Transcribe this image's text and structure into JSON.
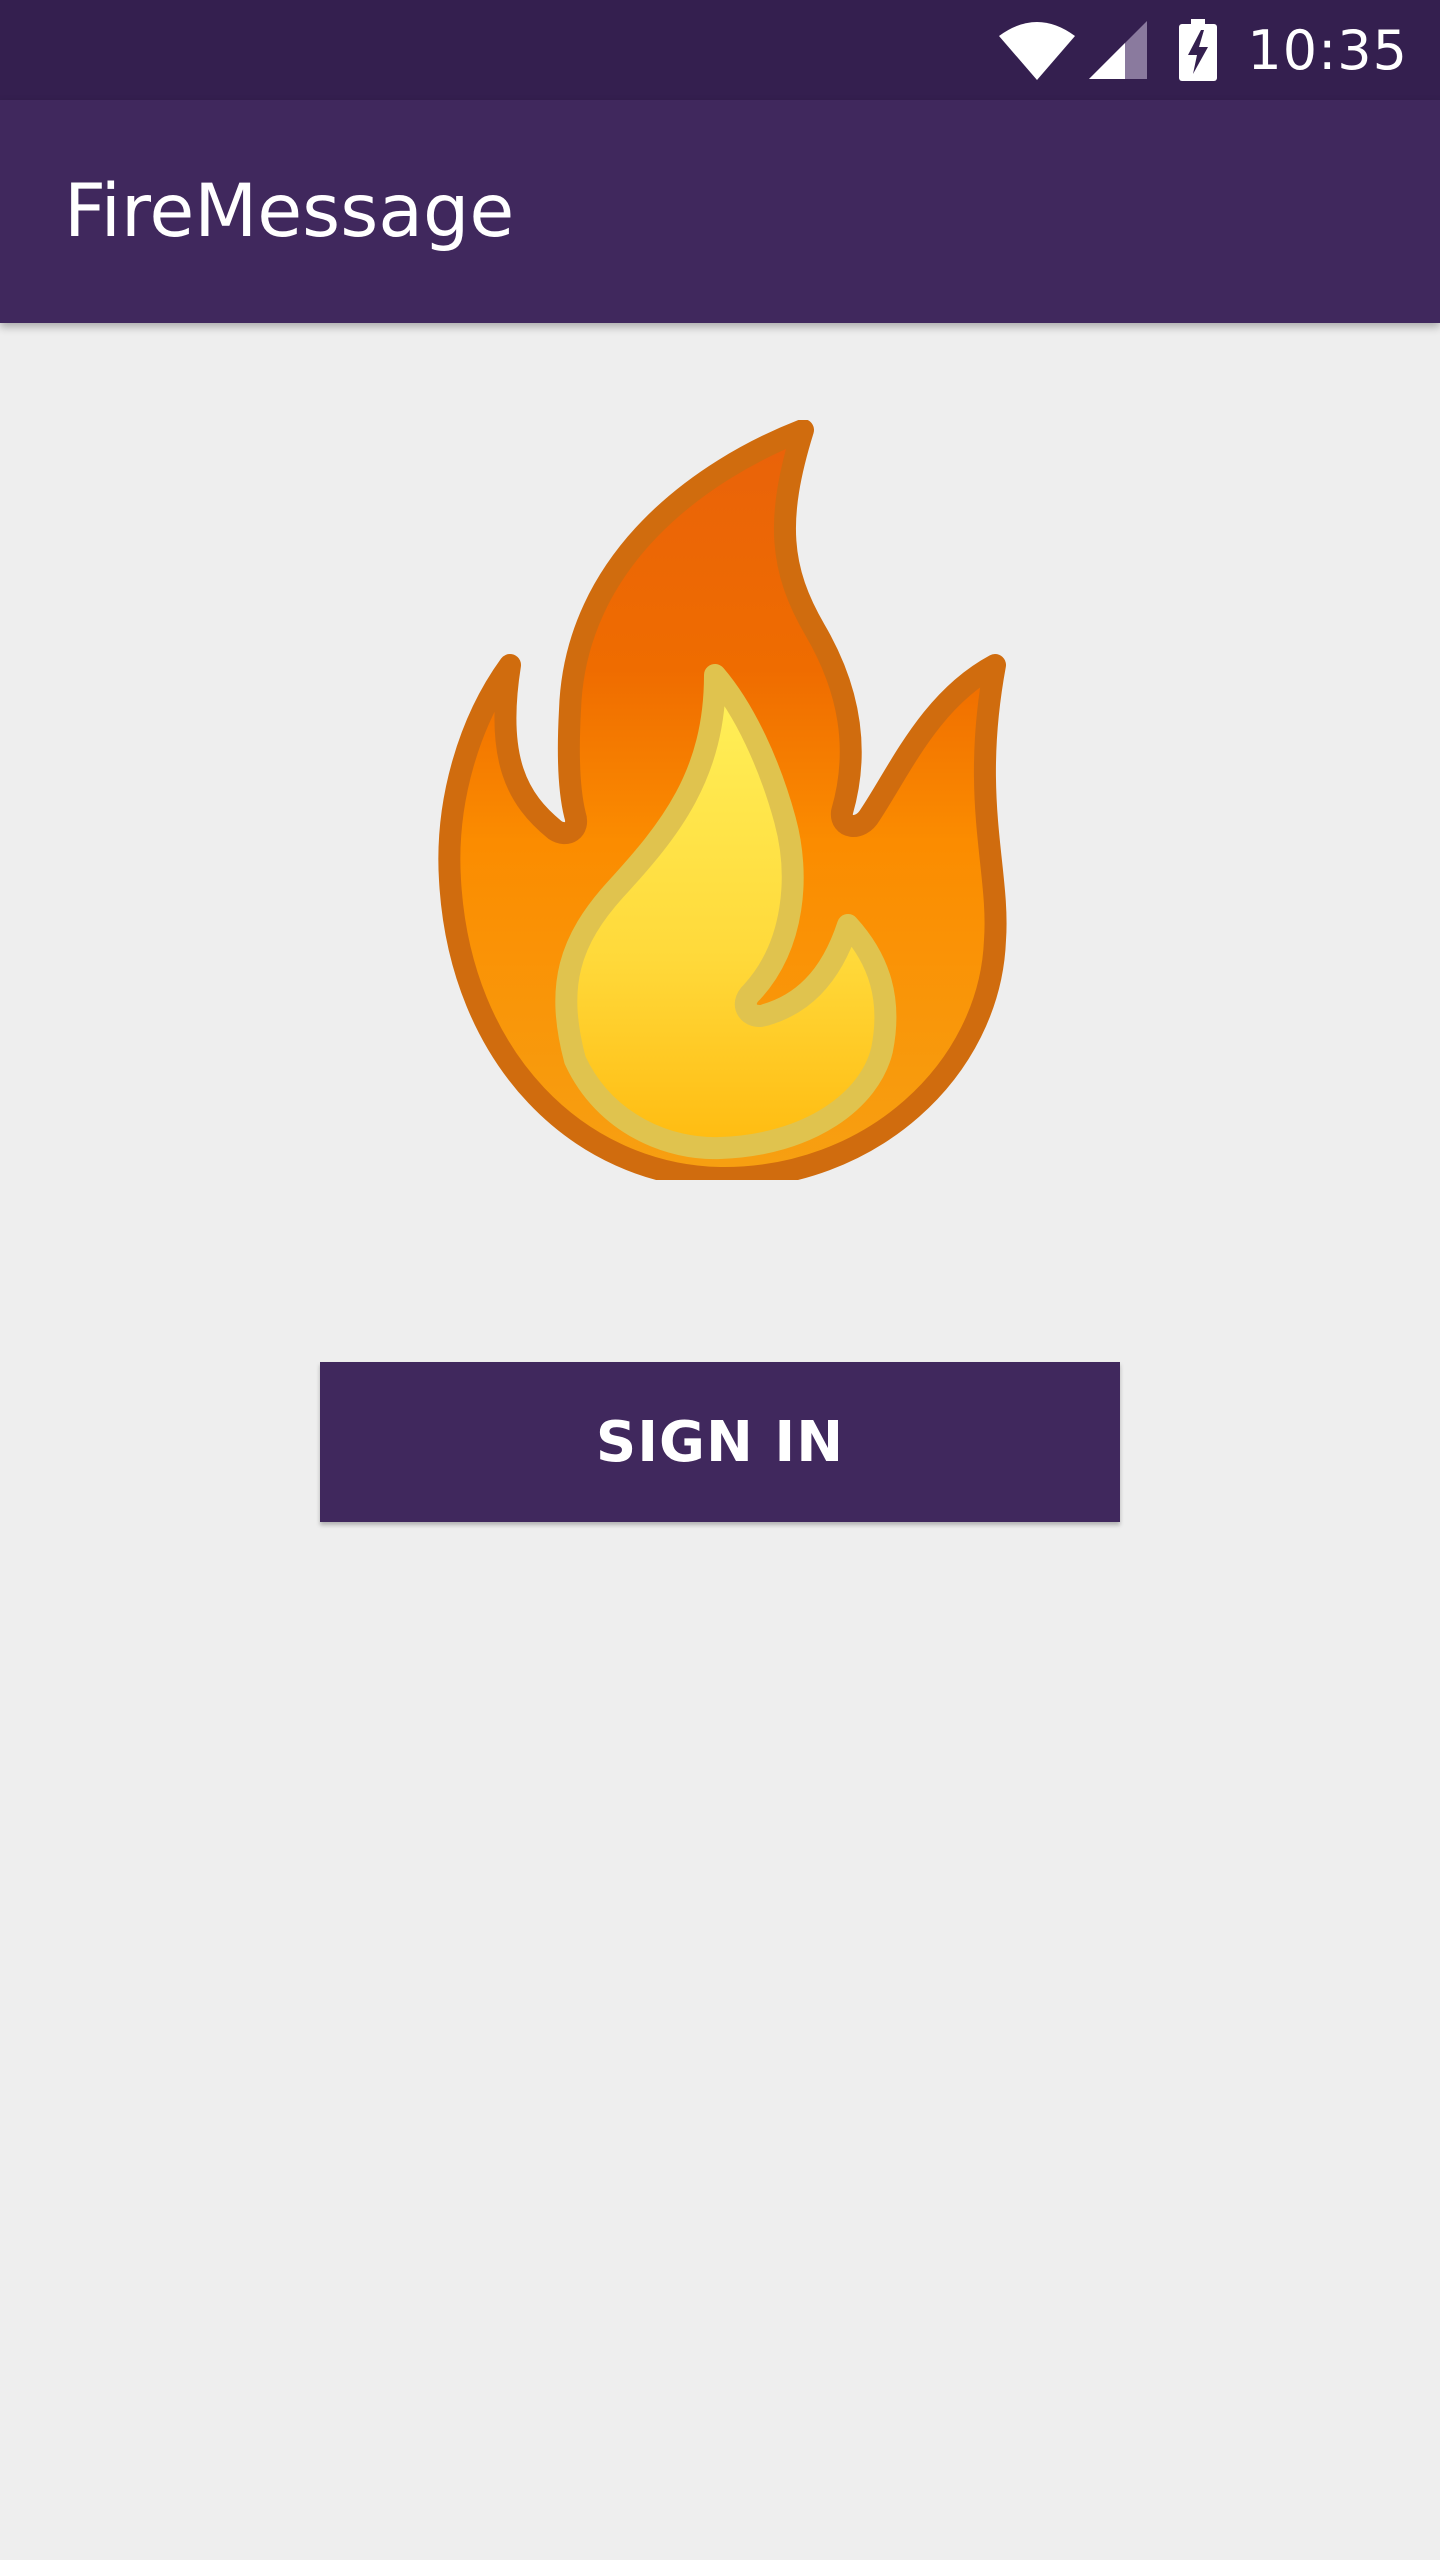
{
  "status_bar": {
    "time": "10:35",
    "icons": [
      "wifi-icon",
      "signal-icon",
      "battery-charging-icon"
    ]
  },
  "app_bar": {
    "title": "FireMessage"
  },
  "logo": {
    "icon": "fire-icon"
  },
  "sign_in": {
    "label": "SIGN IN"
  },
  "colors": {
    "status_bar": "#341f4f",
    "primary": "#40285d",
    "background": "#eeeeee",
    "flame_outer": "#f57c00",
    "flame_inner": "#ffe14d"
  }
}
